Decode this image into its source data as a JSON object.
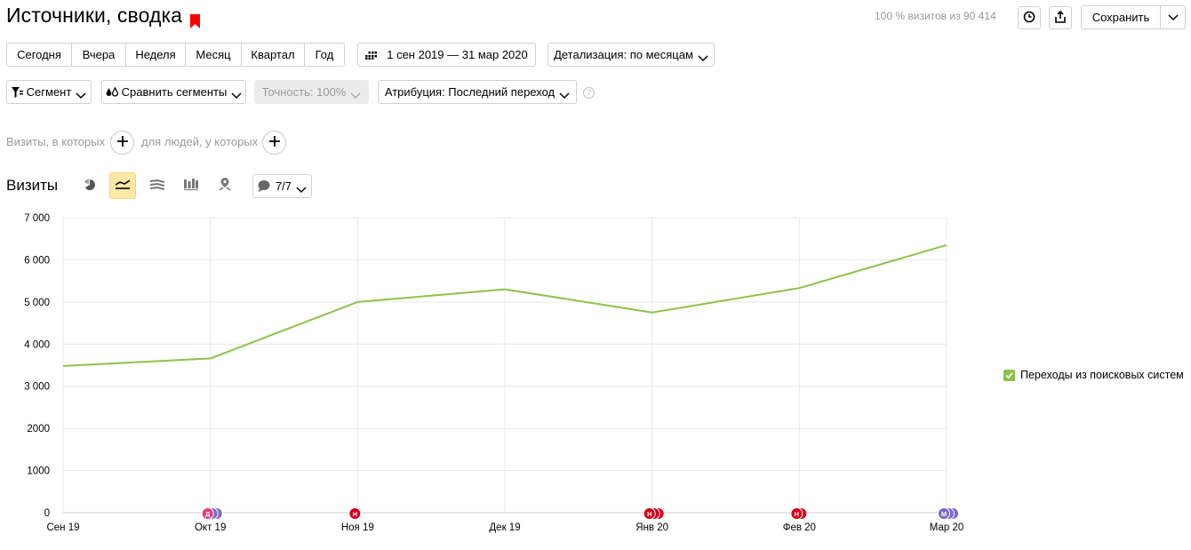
{
  "header": {
    "title": "Источники, сводка",
    "coverage": "100 % визитов из 90 414",
    "save_label": "Сохранить"
  },
  "periods": [
    "Сегодня",
    "Вчера",
    "Неделя",
    "Месяц",
    "Квартал",
    "Год"
  ],
  "date_range": "1 сен 2019 — 31 мар 2020",
  "detail": "Детализация: по месяцам",
  "filters": {
    "segment": "Сегмент",
    "compare": "Сравнить сегменты",
    "accuracy": "Точность: 100%",
    "attribution": "Атрибуция: Последний переход",
    "help": "?"
  },
  "conditions": {
    "visits_label": "Визиты, в которых",
    "people_label": "для людей, у которых"
  },
  "chart_header": {
    "title": "Визиты",
    "notes_label": "7/7"
  },
  "colors": {
    "accent": "#ffe8a6",
    "bookmark": "#ff0000",
    "series": "#8bc34a",
    "annotation_red": "#d5001c",
    "annotation_pink": "#e0407a",
    "annotation_purple": "#7e68c8"
  },
  "chart_data": {
    "type": "line",
    "categories": [
      "Сен 19",
      "Окт 19",
      "Ноя 19",
      "Дек 19",
      "Янв 20",
      "Фев 20",
      "Мар 20"
    ],
    "series": [
      {
        "name": "Переходы из поисковых систем",
        "values": [
          3480,
          3660,
          5000,
          5300,
          4750,
          5330,
          6350
        ]
      }
    ],
    "ylim": [
      0,
      7000
    ],
    "yticks": [
      0,
      1000,
      2000,
      3000,
      4000,
      5000,
      6000,
      7000
    ],
    "ytick_labels": [
      "0",
      "1000",
      "2000",
      "3 000",
      "4 000",
      "5 000",
      "6 000",
      "7 000"
    ],
    "grid": true,
    "legend": "right",
    "annotations": [
      {
        "category_index": 1,
        "letter": "Д",
        "count": 3,
        "colors": [
          "#e0407a",
          "#7e68c8",
          "#7e68c8"
        ]
      },
      {
        "category_index": 2,
        "letter": "Н",
        "count": 1,
        "colors": [
          "#d5001c"
        ]
      },
      {
        "category_index": 4,
        "letter": "Н",
        "count": 3,
        "colors": [
          "#d5001c",
          "#d5001c",
          "#d5001c"
        ]
      },
      {
        "category_index": 5,
        "letter": "Н",
        "count": 2,
        "colors": [
          "#d5001c",
          "#d5001c"
        ]
      },
      {
        "category_index": 6,
        "letter": "М",
        "count": 3,
        "colors": [
          "#7e68c8",
          "#7e68c8",
          "#7e68c8"
        ]
      }
    ]
  }
}
